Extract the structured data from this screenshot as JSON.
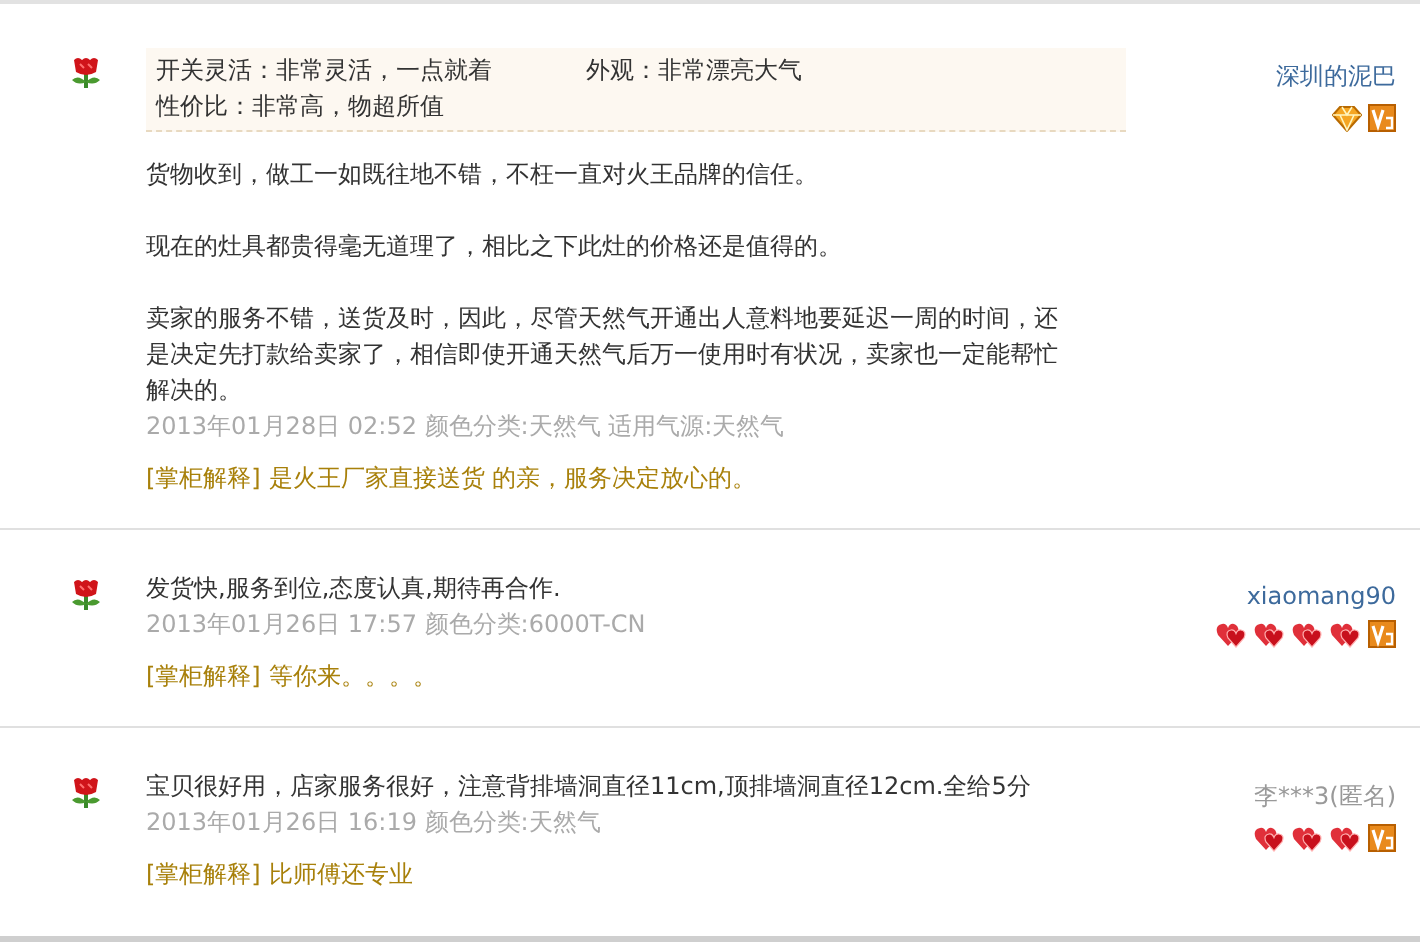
{
  "reviews": [
    {
      "tags": [
        {
          "label": "开关灵活：非常灵活，一点就着"
        },
        {
          "label": "外观：非常漂亮大气"
        },
        {
          "label": "性价比：非常高，物超所值"
        }
      ],
      "paragraphs": [
        "货物收到，做工一如既往地不错，不枉一直对火王品牌的信任。",
        "现在的灶具都贵得毫无道理了，相比之下此灶的价格还是值得的。",
        "卖家的服务不错，送货及时，因此，尽管天然气开通出人意料地要延迟一周的时间，还是决定先打款给卖家了，相信即使开通天然气后万一使用时有状况，卖家也一定能帮忙解决的。"
      ],
      "meta": "2013年01月28日 02:52 颜色分类:天然气  适用气源:天然气",
      "reply_label": "[掌柜解释]",
      "reply": "是火王厂家直接送货 的亲，服务决定放心的。",
      "user": "深圳的泥巴",
      "anonymous": false,
      "rank_icons": [
        {
          "kind": "diamond"
        }
      ]
    },
    {
      "paragraphs": [
        "发货快,服务到位,态度认真,期待再合作."
      ],
      "meta": "2013年01月26日 17:57 颜色分类:6000T-CN",
      "reply_label": "[掌柜解释]",
      "reply": "等你来。。。。",
      "user": "xiaomang90",
      "anonymous": false,
      "rank_icons": [
        {
          "kind": "heart"
        },
        {
          "kind": "heart"
        },
        {
          "kind": "heart"
        },
        {
          "kind": "heart"
        }
      ]
    },
    {
      "paragraphs": [
        "宝贝很好用，店家服务很好，注意背排墙洞直径11cm,顶排墙洞直径12cm.全给5分"
      ],
      "meta": "2013年01月26日 16:19 颜色分类:天然气",
      "reply_label": "[掌柜解释]",
      "reply": "比师傅还专业",
      "user": "李***3(匿名)",
      "anonymous": true,
      "rank_icons": [
        {
          "kind": "heart"
        },
        {
          "kind": "heart"
        },
        {
          "kind": "heart"
        }
      ]
    }
  ]
}
